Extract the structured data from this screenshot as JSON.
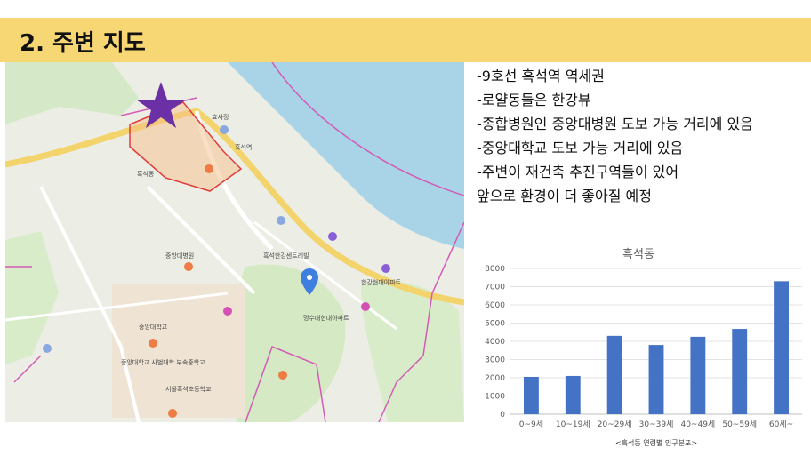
{
  "header": {
    "title": "2. 주변 지도"
  },
  "map": {
    "labels": [
      "흑석동",
      "한강현대아파트",
      "중앙대학교",
      "흑석역",
      "중앙대병원",
      "효사정",
      "서울흑석초등학교",
      "명수대현대아파트",
      "흑석한강센트레빌",
      "중앙대학교 사범대학 부속중학교"
    ]
  },
  "bullets": [
    "-9호선 흑석역 역세권",
    "-로얄동들은 한강뷰",
    "-종합병원인 중앙대병원 도보 가능 거리에 있음",
    "-중앙대학교 도보 가능 거리에 있음",
    "-주변이 재건축 추진구역들이 있어\n앞으로 환경이 더 좋아질 예정"
  ],
  "chart_data": {
    "type": "bar",
    "title": "흑석동",
    "categories": [
      "0~9세",
      "10~19세",
      "20~29세",
      "30~39세",
      "40~49세",
      "50~59세",
      "60세~"
    ],
    "values": [
      2050,
      2100,
      4300,
      3800,
      4250,
      4680,
      7300
    ],
    "ylim": [
      0,
      8000
    ],
    "yticks": [
      0,
      1000,
      2000,
      3000,
      4000,
      5000,
      6000,
      7000,
      8000
    ],
    "grid": true,
    "caption": "<흑석동 연령별 인구분포>",
    "bar_color": "#4472c4"
  }
}
